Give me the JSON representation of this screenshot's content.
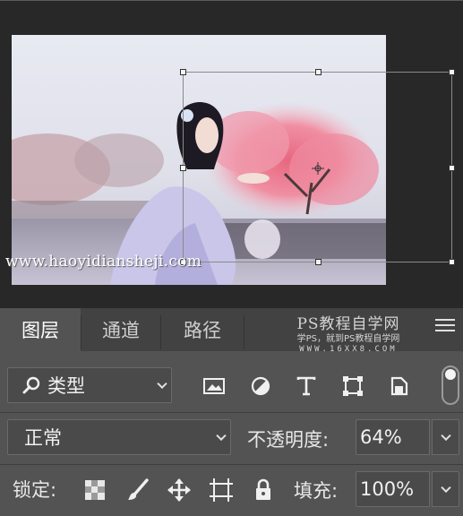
{
  "canvas": {
    "watermark_url": "www.haoyidiansheji.com"
  },
  "panel": {
    "tabs": [
      {
        "label": "图层",
        "active": true
      },
      {
        "label": "通道",
        "active": false
      },
      {
        "label": "路径",
        "active": false
      }
    ],
    "brand": {
      "title": "PS教程自学网",
      "subtitle": "学PS，就到PS教程自学网",
      "url": "WWW.16XX8.COM"
    },
    "filter": {
      "selected": "类型",
      "icons": [
        "image-filter-icon",
        "adjustment-filter-icon",
        "type-filter-icon",
        "shape-filter-icon",
        "smart-object-filter-icon"
      ]
    },
    "blend": {
      "mode": "正常",
      "opacity_label": "不透明度:",
      "opacity_value": "64%"
    },
    "lock": {
      "label": "锁定:",
      "icons": [
        "lock-transparent-pixels-icon",
        "lock-image-pixels-icon",
        "lock-position-icon",
        "lock-artboard-icon",
        "lock-all-icon"
      ]
    },
    "fill": {
      "label": "填充:",
      "value": "100%"
    },
    "colors": {
      "panel_bg": "#535353",
      "tabbar_bg": "#424242",
      "canvas_bg": "#282828"
    }
  }
}
